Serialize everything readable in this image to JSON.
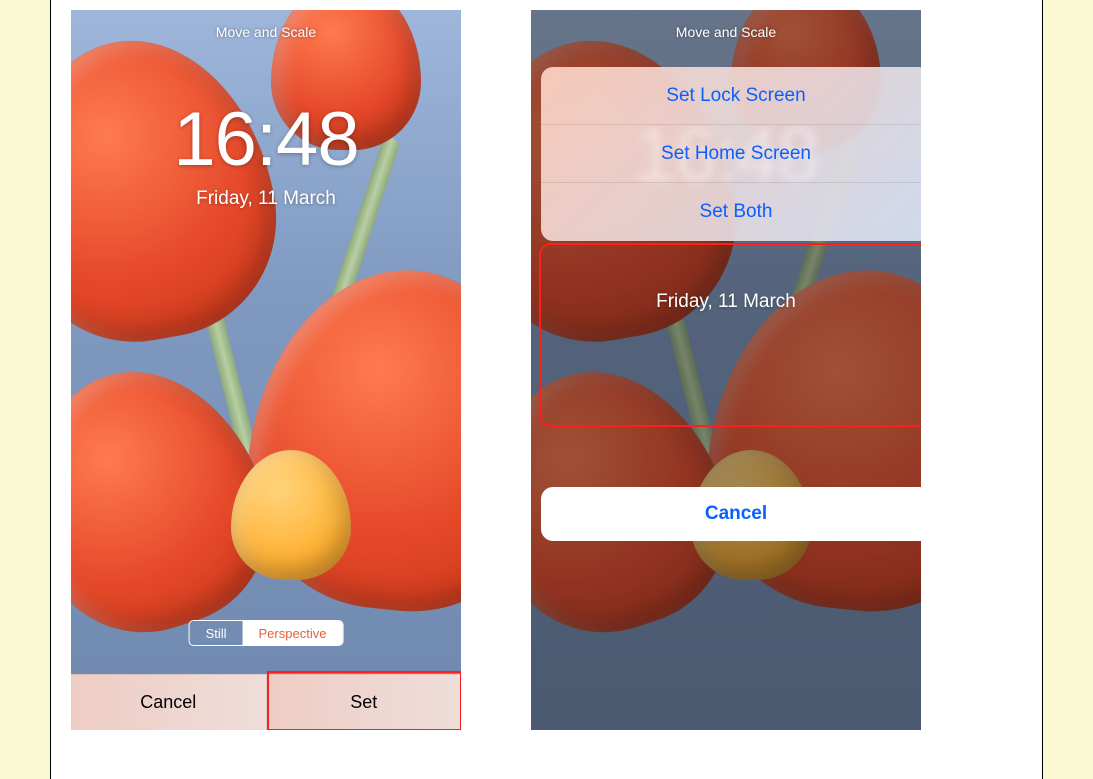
{
  "left": {
    "header_title": "Move and Scale",
    "time": "16:48",
    "date": "Friday, 11 March",
    "segmented": {
      "still_label": "Still",
      "perspective_label": "Perspective",
      "selected": "perspective"
    },
    "buttons": {
      "cancel": "Cancel",
      "set": "Set"
    }
  },
  "right": {
    "header_title": "Move and Scale",
    "time": "16:48",
    "date": "Friday, 11 March",
    "sheet": {
      "set_lock": "Set Lock Screen",
      "set_home": "Set Home Screen",
      "set_both": "Set Both"
    },
    "cancel": "Cancel"
  },
  "colors": {
    "ios_blue": "#0a60ff",
    "highlight_red": "#ff1e1e"
  }
}
